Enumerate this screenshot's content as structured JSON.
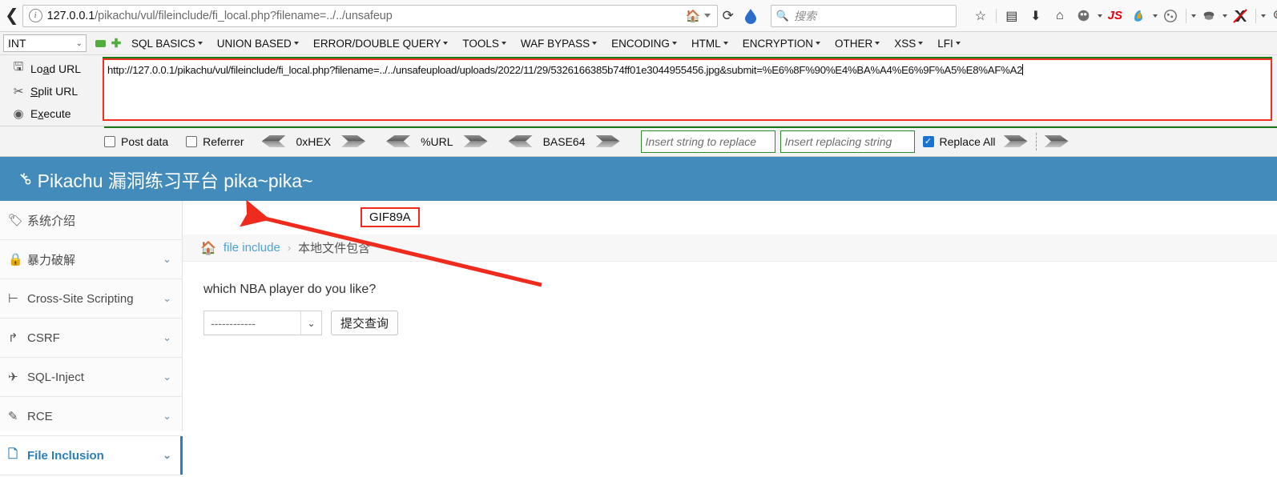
{
  "browser": {
    "back_icon": "back-arrow",
    "info_icon": "info-circle",
    "url_host": "127.0.0.1",
    "url_path": "/pikachu/vul/fileinclude/fi_local.php?filename=../../unsafeup",
    "home_icon": "home-house",
    "reload_icon": "reload",
    "search_placeholder": "搜索",
    "toolbar_icons": [
      "star-icon",
      "library-icon",
      "download-icon",
      "home-icon",
      "ghost-icon",
      "js-icon",
      "firebug-icon",
      "cookie-icon",
      "wappalyzer-icon",
      "noscript-icon",
      "magnifier-icon"
    ]
  },
  "hackbar": {
    "type_select": "INT",
    "minus_label": "−",
    "plus_label": "+",
    "menu": [
      "SQL BASICS",
      "UNION BASED",
      "ERROR/DOUBLE QUERY",
      "TOOLS",
      "WAF BYPASS",
      "ENCODING",
      "HTML",
      "ENCRYPTION",
      "OTHER",
      "XSS",
      "LFI"
    ],
    "actions": [
      {
        "label": "Load URL",
        "icon": "load-url-icon"
      },
      {
        "label": "Split URL",
        "icon": "scissors-icon"
      },
      {
        "label": "Execute",
        "icon": "execute-play-icon"
      }
    ],
    "url_value": "http://127.0.0.1/pikachu/vul/fileinclude/fi_local.php?filename=../../unsafeupload/uploads/2022/11/29/5326166385b74ff01e3044955456.jpg&submit=%E6%8F%90%E4%BA%A4%E6%9F%A5%E8%AF%A2",
    "options": {
      "post_data_label": "Post data",
      "post_data_checked": false,
      "referrer_label": "Referrer",
      "referrer_checked": false,
      "encoders": [
        "0xHEX",
        "%URL",
        "BASE64"
      ],
      "replace_from_placeholder": "Insert string to replace",
      "replace_to_placeholder": "Insert replacing string",
      "replace_all_label": "Replace All",
      "replace_all_checked": true
    }
  },
  "pikachu": {
    "brand_title": "Pikachu 漏洞练习平台 pika~pika~",
    "brand_icon": "magnifier-key-icon",
    "header_color": "#428bba",
    "sidebar": [
      {
        "label": "系统介绍",
        "icon": "tag-icon",
        "chevron": "",
        "active": false
      },
      {
        "label": "暴力破解",
        "icon": "lock-icon",
        "chevron": "⌄",
        "active": false
      },
      {
        "label": "Cross-Site Scripting",
        "icon": "xss-icon",
        "chevron": "⌄",
        "active": false
      },
      {
        "label": "CSRF",
        "icon": "share-icon",
        "chevron": "⌄",
        "active": false
      },
      {
        "label": "SQL-Inject",
        "icon": "needle-icon",
        "chevron": "⌄",
        "active": false
      },
      {
        "label": "RCE",
        "icon": "pencil-icon",
        "chevron": "⌄",
        "active": false
      },
      {
        "label": "File Inclusion",
        "icon": "file-icon",
        "chevron": "⌄",
        "active": true
      }
    ],
    "gif_header_text": "GIF89A",
    "breadcrumb": {
      "home_icon": "home-icon",
      "link": "file include",
      "separator": "›",
      "current": "本地文件包含"
    },
    "form": {
      "question": "which NBA player do you like?",
      "select_value": "------------",
      "select_chevron": "⌄",
      "submit_label": "提交查询"
    }
  },
  "annotations": {
    "arrow_color": "#ef2b1d",
    "highlight_border_color": "#f02b1d"
  }
}
